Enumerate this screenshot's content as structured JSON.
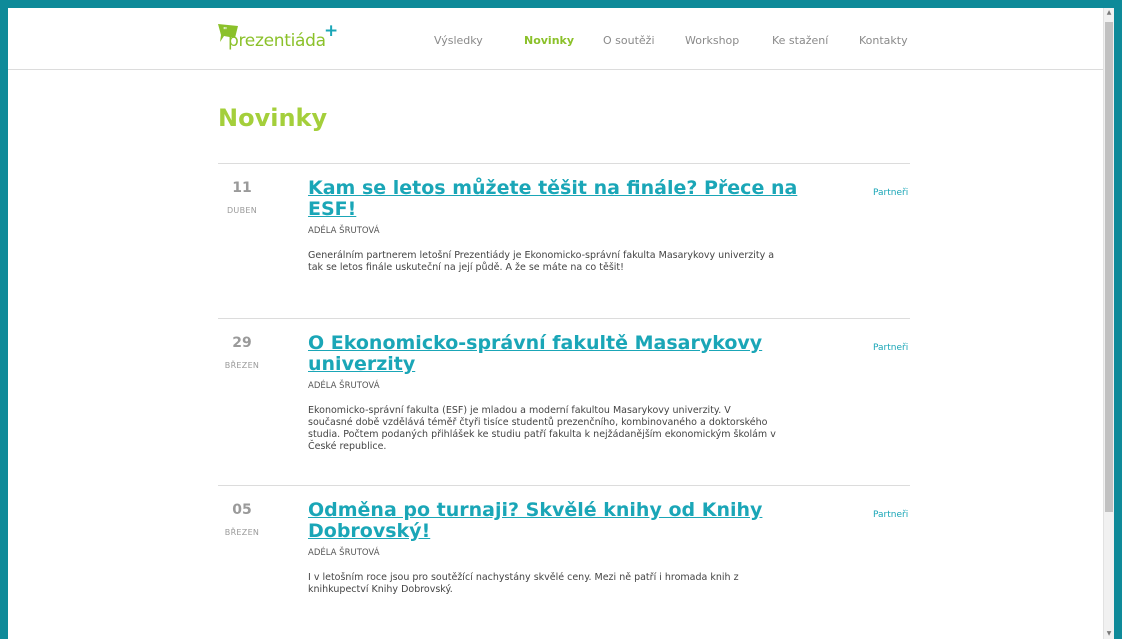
{
  "site": {
    "logo_text": "prezentiáda",
    "logo_plus": "+"
  },
  "nav": [
    {
      "label": "Výsledky",
      "active": false
    },
    {
      "label": "Novinky",
      "active": true
    },
    {
      "label": "O soutěži",
      "active": false
    },
    {
      "label": "Workshop",
      "active": false
    },
    {
      "label": "Ke stažení",
      "active": false
    },
    {
      "label": "Kontakty",
      "active": false
    }
  ],
  "page": {
    "title": "Novinky"
  },
  "articles": [
    {
      "day": "11",
      "month": "DUBEN",
      "title": "Kam se letos můžete těšit na finále? Přece na ESF!",
      "author": "ADÉLA ŠRUTOVÁ",
      "excerpt": "Generálním partnerem letošní Prezentiády je Ekonomicko-správní fakulta Masarykovy univerzity a tak se letos finále uskuteční na její půdě. A že se máte na co těšit!",
      "tag": "Partneři"
    },
    {
      "day": "29",
      "month": "BŘEZEN",
      "title": "O Ekonomicko-správní fakultě Masarykovy univerzity",
      "author": "ADÉLA ŠRUTOVÁ",
      "excerpt": "Ekonomicko-správní fakulta (ESF) je mladou a moderní fakultou Masarykovy univerzity. V současné době vzdělává téměř čtyři tisíce studentů prezenčního, kombinovaného a doktorského studia. Počtem podaných přihlášek ke studiu patří fakulta k nejžádanějším ekonomickým školám v České republice.",
      "tag": "Partneři"
    },
    {
      "day": "05",
      "month": "BŘEZEN",
      "title": "Odměna po turnaji? Skvělé knihy od Knihy Dobrovský!",
      "author": "ADÉLA ŠRUTOVÁ",
      "excerpt": "I v letošním roce jsou pro soutěžící nachystány skvělé ceny. Mezi ně patří i hromada knih z knihkupectví Knihy Dobrovský.",
      "tag": "Partneři"
    }
  ],
  "colors": {
    "accent_green": "#a4cf3b",
    "link_teal": "#1aa6b7",
    "frame_teal": "#0e8a99"
  }
}
